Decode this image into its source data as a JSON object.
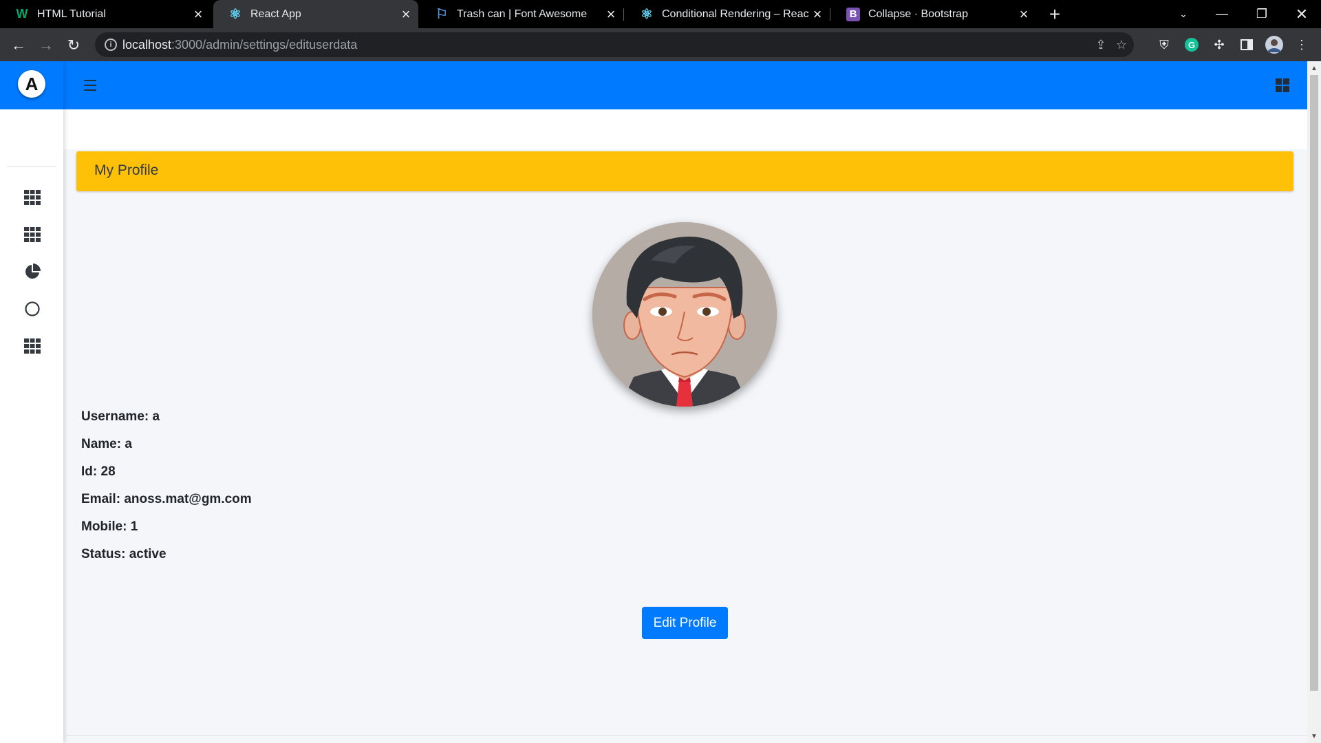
{
  "browser": {
    "tabs": [
      {
        "title": "HTML Tutorial",
        "favicon": "w3schools-icon",
        "favicon_glyph": "W",
        "favicon_color": "#04aa6d",
        "active": false
      },
      {
        "title": "React App",
        "favicon": "react-icon",
        "favicon_glyph": "⚛",
        "favicon_color": "#61dafb",
        "active": true
      },
      {
        "title": "Trash can | Font Awesome",
        "favicon": "flag-icon",
        "favicon_glyph": "⚐",
        "favicon_color": "#528dd7",
        "active": false
      },
      {
        "title": "Conditional Rendering – React",
        "favicon": "react-icon",
        "favicon_glyph": "⚛",
        "favicon_color": "#61dafb",
        "active": false
      },
      {
        "title": "Collapse · Bootstrap",
        "favicon": "bootstrap-icon",
        "favicon_glyph": "B",
        "favicon_color": "#7952b3",
        "active": false
      }
    ],
    "url_host": "localhost",
    "url_path": ":3000/admin/settings/edituserdata"
  },
  "profile": {
    "header_title": "My Profile",
    "fields": [
      {
        "label": "Username:",
        "value": "a"
      },
      {
        "label": "Name:",
        "value": "a"
      },
      {
        "label": "Id:",
        "value": "28"
      },
      {
        "label": "Email:",
        "value": "anoss.mat@gm.com"
      },
      {
        "label": "Mobile:",
        "value": "1"
      },
      {
        "label": "Status:",
        "value": "active"
      }
    ],
    "edit_button": "Edit Profile"
  },
  "sidebar": {
    "logo_letter": "A",
    "items": [
      {
        "icon": "th-icon"
      },
      {
        "icon": "th-icon"
      },
      {
        "icon": "chart-pie-icon"
      },
      {
        "icon": "circle-icon"
      },
      {
        "icon": "th-icon"
      }
    ]
  },
  "colors": {
    "primary": "#007bff",
    "header_warning": "#ffc107",
    "page_bg": "#f4f6f9"
  }
}
